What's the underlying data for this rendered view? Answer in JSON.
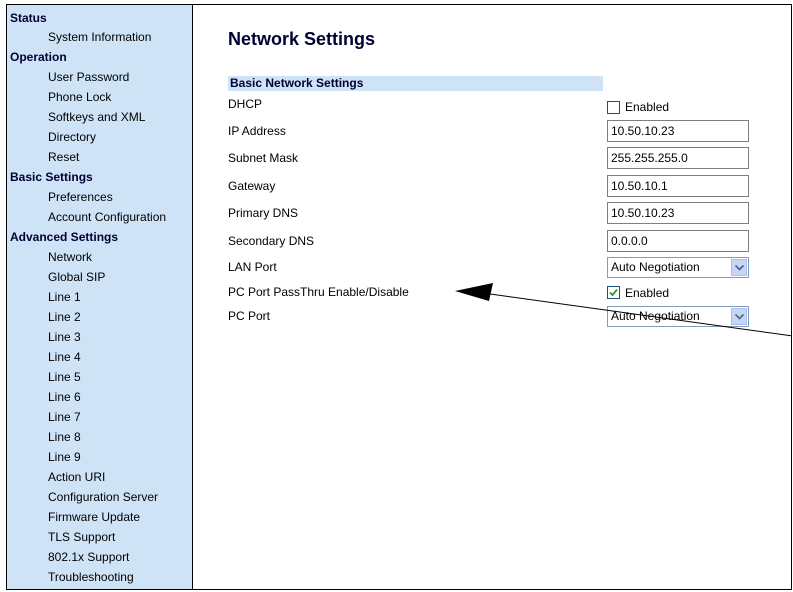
{
  "sidebar": {
    "sections": [
      {
        "label": "Status",
        "items": [
          "System Information"
        ]
      },
      {
        "label": "Operation",
        "items": [
          "User Password",
          "Phone Lock",
          "Softkeys and XML",
          "Directory",
          "Reset"
        ]
      },
      {
        "label": "Basic Settings",
        "items": [
          "Preferences",
          "Account Configuration"
        ]
      },
      {
        "label": "Advanced Settings",
        "items": [
          "Network",
          "Global SIP",
          "Line 1",
          "Line 2",
          "Line 3",
          "Line 4",
          "Line 5",
          "Line 6",
          "Line 7",
          "Line 8",
          "Line 9",
          "Action URI",
          "Configuration Server",
          "Firmware Update",
          "TLS Support",
          "802.1x Support",
          "Troubleshooting"
        ]
      }
    ]
  },
  "main": {
    "title": "Network Settings",
    "section_header": "Basic Network Settings",
    "fields": {
      "dhcp": {
        "label": "DHCP",
        "checked": false,
        "check_label": "Enabled"
      },
      "ip_address": {
        "label": "IP Address",
        "value": "10.50.10.23"
      },
      "subnet_mask": {
        "label": "Subnet Mask",
        "value": "255.255.255.0"
      },
      "gateway": {
        "label": "Gateway",
        "value": "10.50.10.1"
      },
      "primary_dns": {
        "label": "Primary DNS",
        "value": "10.50.10.23"
      },
      "secondary_dns": {
        "label": "Secondary DNS",
        "value": "0.0.0.0"
      },
      "lan_port": {
        "label": "LAN Port",
        "value": "Auto Negotiation"
      },
      "pc_passthru": {
        "label": "PC Port PassThru Enable/Disable",
        "checked": true,
        "check_label": "Enabled"
      },
      "pc_port": {
        "label": "PC Port",
        "value": "Auto Negotiation"
      }
    }
  },
  "colors": {
    "sidebar_bg": "#cfe3f7",
    "title": "#000033"
  }
}
